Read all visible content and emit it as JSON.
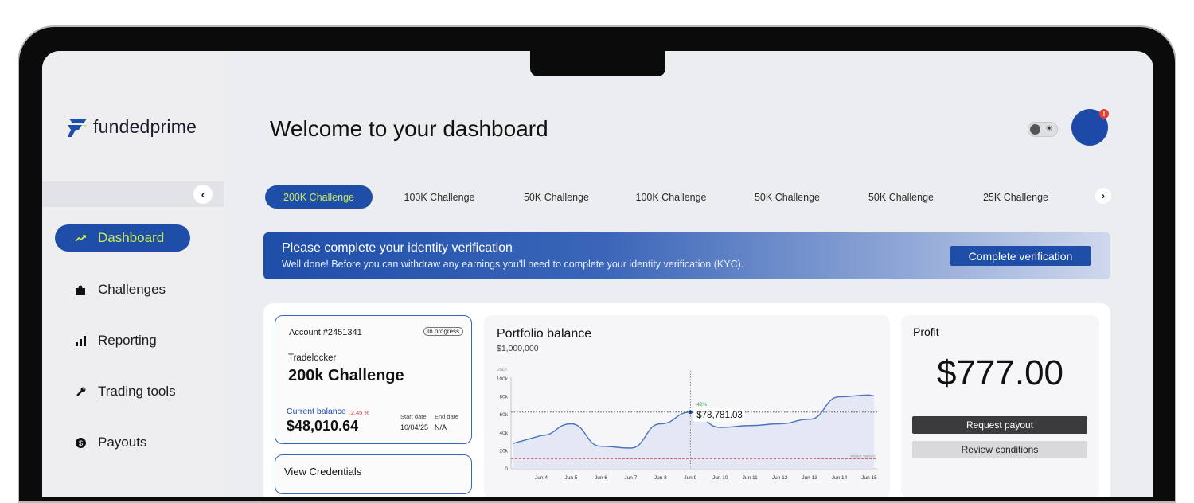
{
  "brand": {
    "name": "fundedprime",
    "accent": "#1f4ea9",
    "highlight": "#c7ea54"
  },
  "header": {
    "title": "Welcome to your dashboard",
    "theme_toggle_icon": "sun-icon"
  },
  "sidebar": {
    "collapse_icon": "chevron-left-icon",
    "items": [
      {
        "label": "Dashboard",
        "icon": "trend-up-icon",
        "active": true
      },
      {
        "label": "Challenges",
        "icon": "puzzle-icon"
      },
      {
        "label": "Reporting",
        "icon": "bar-chart-icon"
      },
      {
        "label": "Trading tools",
        "icon": "wrench-icon"
      },
      {
        "label": "Payouts",
        "icon": "dollar-coin-icon"
      }
    ]
  },
  "tabs": [
    {
      "label": "200K Challenge",
      "active": true
    },
    {
      "label": "100K Challenge"
    },
    {
      "label": "50K Challenge"
    },
    {
      "label": "100K Challenge"
    },
    {
      "label": "50K Challenge"
    },
    {
      "label": "50K Challenge"
    },
    {
      "label": "25K Challenge"
    }
  ],
  "banner": {
    "title": "Please complete your identity verification",
    "subtitle": "Well done! Before you can withdraw any earnings you'll need to complete your identity verification (KYC).",
    "button": "Complete verification"
  },
  "account": {
    "number": "Account #2451341",
    "status": "In progress",
    "platform": "Tradelocker",
    "name": "200k Challenge",
    "balance_label": "Current balance",
    "balance_change": "↓2.45 %",
    "balance": "$48,010.64",
    "start_label": "Start date",
    "start_value": "10/04/25",
    "end_label": "End date",
    "end_value": "N/A",
    "credentials_label": "View Credentials"
  },
  "profit": {
    "label": "Profit",
    "value": "$777.00",
    "payout_button": "Request payout",
    "review_button": "Review conditions"
  },
  "chart_data": {
    "type": "area",
    "title": "Portfolio balance",
    "subtitle": "$1,000,000",
    "y_unit_label": "USDT",
    "x": [
      "Jun 4",
      "Jun 5",
      "Jun 6",
      "Jun 7",
      "Jun 8",
      "Jun 9",
      "Jun 10",
      "Jun 11",
      "Jun 12",
      "Jun 13",
      "Jun 14",
      "Jun 15"
    ],
    "y_ticks": [
      "0",
      "20k",
      "40k",
      "60k",
      "80k",
      "100k"
    ],
    "ylim": [
      0,
      100
    ],
    "series": [
      {
        "values": [
          37,
          50,
          25,
          23,
          50,
          63,
          46,
          48,
          50,
          55,
          80,
          82
        ]
      }
    ],
    "reference_lines": [
      {
        "value": 63,
        "style": "dotted",
        "color": "#333333"
      },
      {
        "value": 11,
        "style": "dashed",
        "color": "#e05555",
        "label": "PROFIT TARGET"
      }
    ],
    "marker": {
      "x": "Jun 9",
      "value": "$78,781.03",
      "change": "42%"
    }
  }
}
